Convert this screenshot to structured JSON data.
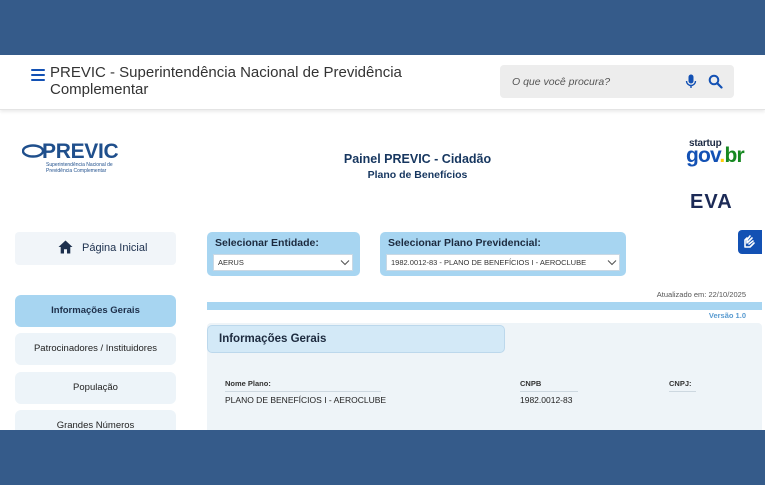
{
  "header": {
    "title": "PREVIC - Superintendência Nacional de Previdência Complementar",
    "search_placeholder": "O que você procura?"
  },
  "logos": {
    "previc_name": "PREVIC",
    "previc_subtitle": "Superintendência Nacional de Previdência Complementar",
    "startup_small": "startup",
    "govbr": {
      "g": "gov",
      "dot": ".",
      "br": "br"
    },
    "eva": "EVA"
  },
  "panel": {
    "title": "Painel PREVIC - Cidadão",
    "subtitle": "Plano de Benefícios"
  },
  "sidebar": {
    "home_label": "Página Inicial",
    "items": [
      {
        "label": "Informações Gerais",
        "active": true
      },
      {
        "label": "Patrocinadores / Instituidores",
        "active": false
      },
      {
        "label": "População",
        "active": false
      },
      {
        "label": "Grandes Números",
        "active": false
      }
    ]
  },
  "selectors": {
    "entity": {
      "label": "Selecionar Entidade:",
      "value": "AERUS"
    },
    "plan": {
      "label": "Selecionar Plano Previdencial:",
      "value": "1982.0012-83 - PLANO DE BENEFÍCIOS I - AEROCLUBE"
    }
  },
  "status": {
    "updated": "Atualizado em: 22/10/2025",
    "version": "Versão 1.0"
  },
  "info": {
    "title": "Informações Gerais",
    "fields": {
      "nome_plano": {
        "label": "Nome Plano:",
        "value": "PLANO DE BENEFÍCIOS I - AEROCLUBE"
      },
      "cnpb": {
        "label": "CNPB",
        "value": "1982.0012-83"
      },
      "cnpj": {
        "label": "CNPJ:",
        "value": ""
      }
    }
  },
  "colors": {
    "accent_light": "#a7d5f1",
    "primary_blue": "#1351b4",
    "frame": "#355b8a"
  }
}
